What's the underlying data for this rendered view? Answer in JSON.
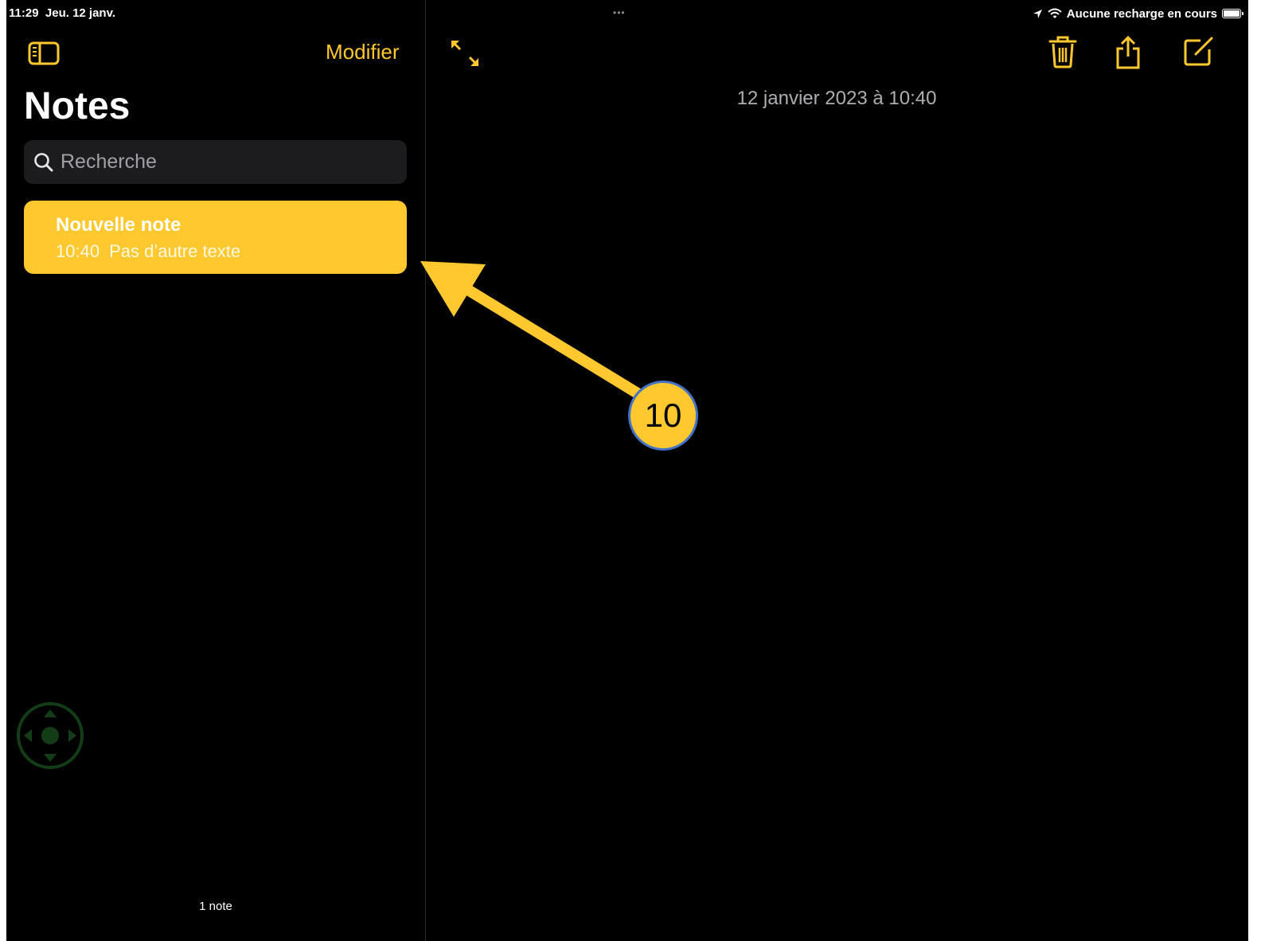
{
  "status_bar": {
    "time": "11:29",
    "date": "Jeu. 12 janv.",
    "multitask_dots": "•••",
    "charging_text": "Aucune recharge en cours"
  },
  "sidebar": {
    "toggle_icon": "sidebar-icon",
    "edit_label": "Modifier",
    "title": "Notes",
    "search_placeholder": "Recherche",
    "notes": [
      {
        "title": "Nouvelle note",
        "time": "10:40",
        "preview": "Pas d’autre texte"
      }
    ],
    "note_count": "1 note"
  },
  "detail": {
    "expand_icon": "expand-icon",
    "toolbar_icons": [
      "trash-icon",
      "share-icon",
      "compose-icon"
    ],
    "date": "12 janvier 2023 à 10:40"
  },
  "annotation": {
    "step_number": "10"
  },
  "colors": {
    "accent": "#ffc82e",
    "background": "#000000",
    "badge_border": "#4472c4"
  }
}
